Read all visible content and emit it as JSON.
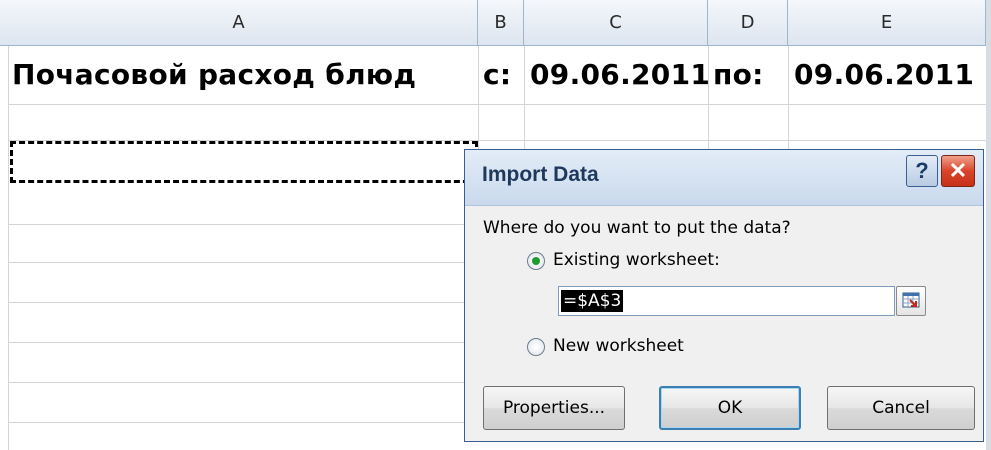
{
  "sheet": {
    "columns": [
      "A",
      "B",
      "C",
      "D",
      "E"
    ],
    "row1": {
      "a": "Почасовой расход блюд",
      "b": "с:",
      "c": "09.06.2011",
      "d": "по:",
      "e": "09.06.2011"
    }
  },
  "dialog": {
    "title": "Import Data",
    "help_label": "?",
    "close_label": "✕",
    "question": "Where do you want to put the data?",
    "options": [
      {
        "label": "Existing worksheet:",
        "selected": true
      },
      {
        "label": "New worksheet",
        "selected": false
      }
    ],
    "reference_value": "=$A$3",
    "buttons": {
      "properties": "Properties...",
      "ok": "OK",
      "cancel": "Cancel"
    }
  }
}
